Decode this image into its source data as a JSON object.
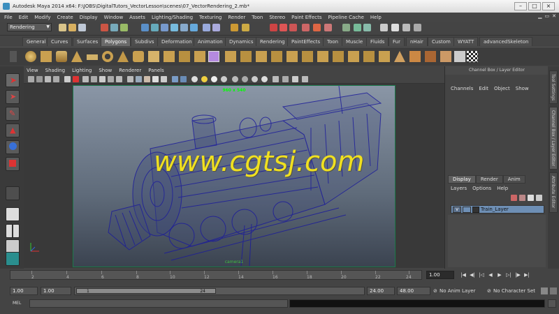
{
  "window": {
    "title": "Autodesk Maya 2014 x64: F:\\JOBS\\DigitalTutors_VectorLesson\\scenes\\07_VectorRendering_2.mb*",
    "min": "–",
    "max": "□",
    "close": "×"
  },
  "menubar": [
    "File",
    "Edit",
    "Modify",
    "Create",
    "Display",
    "Window",
    "Assets",
    "Lighting/Shading",
    "Texturing",
    "Render",
    "Toon",
    "Stereo",
    "Paint Effects",
    "Pipeline Cache",
    "Help"
  ],
  "status": {
    "mode": "Rendering"
  },
  "shelf_tabs": [
    "General",
    "Curves",
    "Surfaces",
    "Polygons",
    "Subdivs",
    "Deformation",
    "Animation",
    "Dynamics",
    "Rendering",
    "PaintEffects",
    "Toon",
    "Muscle",
    "Fluids",
    "Fur",
    "nHair",
    "Custom",
    "WYATT",
    "advancedSkeleton"
  ],
  "active_shelf": "Polygons",
  "panel_menu": [
    "View",
    "Shading",
    "Lighting",
    "Show",
    "Renderer",
    "Panels"
  ],
  "viewport": {
    "resolution_gate": "960 x 540",
    "camera": "camera1",
    "watermark": "www.cgtsj.com"
  },
  "channel_box": {
    "title": "Channel Box / Layer Editor",
    "menu": [
      "Channels",
      "Edit",
      "Object",
      "Show"
    ]
  },
  "layer_editor": {
    "tabs": [
      "Display",
      "Render",
      "Anim"
    ],
    "menu": [
      "Layers",
      "Options",
      "Help"
    ],
    "layer": {
      "visible": "V",
      "name": "Train_Layer"
    }
  },
  "side_tabs": [
    "Tool Settings",
    "Channel Box / Layer Editor",
    "Attribute Editor"
  ],
  "time_slider": {
    "ticks": [
      "2",
      "4",
      "6",
      "8",
      "10",
      "12",
      "14",
      "16",
      "18",
      "20",
      "22",
      "24"
    ],
    "current_frame": "1.00"
  },
  "range_slider": {
    "start": "1.00",
    "start_inner": "1.00",
    "range_left": "1",
    "range_right": "24",
    "end_inner": "24.00",
    "end": "48.00",
    "anim_layer": "No Anim Layer",
    "character_set": "No Character Set"
  },
  "command_line": {
    "label": "MEL"
  }
}
